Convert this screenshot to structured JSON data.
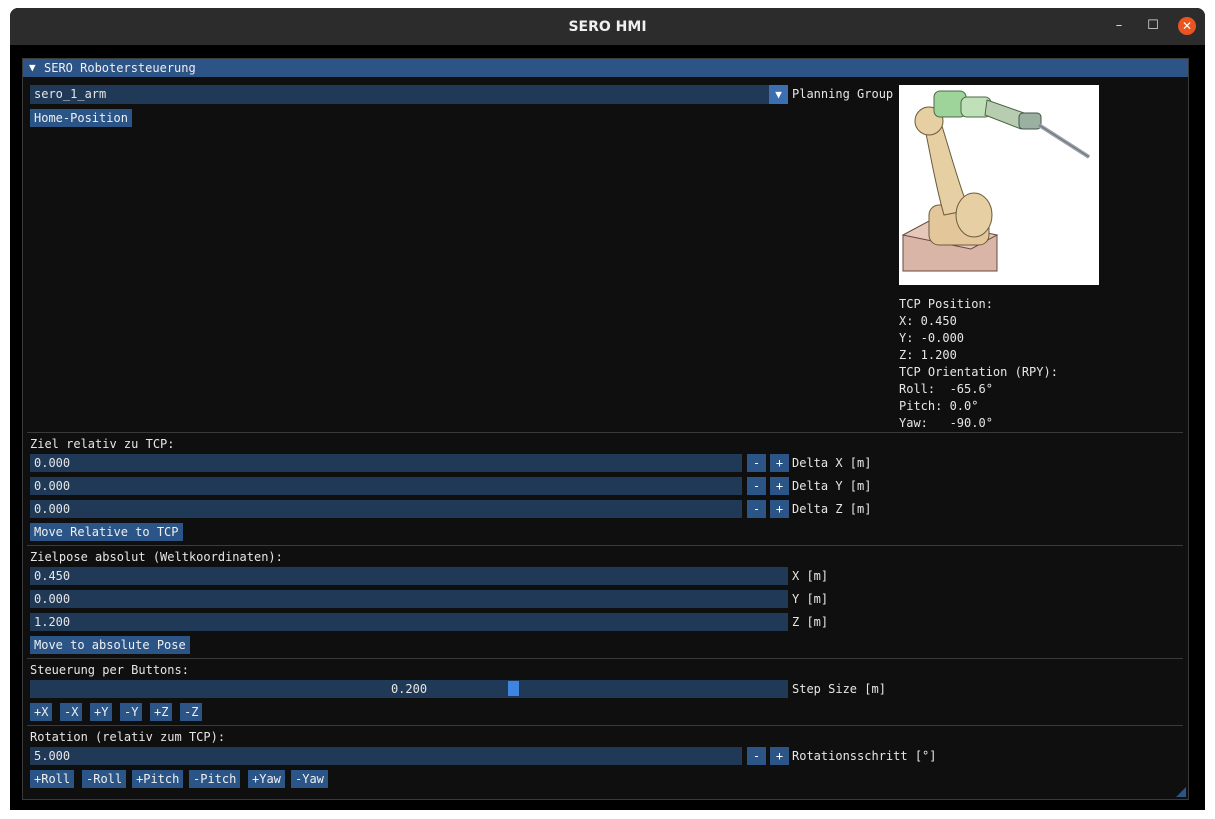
{
  "window": {
    "title": "SERO HMI",
    "min_icon": "minimize-icon",
    "max_icon": "maximize-icon",
    "close_icon": "close-icon",
    "close_color": "#e95420"
  },
  "panel": {
    "header": "SERO Robotersteuerung"
  },
  "planning": {
    "group_value": "sero_1_arm",
    "label": "Planning Group",
    "home_button": "Home-Position"
  },
  "tcp": {
    "position_title": "TCP Position:",
    "x": "X: 0.450",
    "y": "Y: -0.000",
    "z": "Z: 1.200",
    "orientation_title": "TCP Orientation (RPY):",
    "roll": "Roll:  -65.6°",
    "pitch": "Pitch: 0.0°",
    "yaw": "Yaw:   -90.0°"
  },
  "relative": {
    "title": "Ziel relativ zu TCP:",
    "dx": "0.000",
    "dx_label": "Delta X [m]",
    "dy": "0.000",
    "dy_label": "Delta Y [m]",
    "dz": "0.000",
    "dz_label": "Delta Z [m]",
    "minus": "-",
    "plus": "+",
    "move_button": "Move Relative to TCP"
  },
  "absolute": {
    "title": "Zielpose absolut (Weltkoordinaten):",
    "x": "0.450",
    "x_label": "X [m]",
    "y": "0.000",
    "y_label": "Y [m]",
    "z": "1.200",
    "z_label": "Z [m]",
    "move_button": "Move to absolute Pose"
  },
  "buttons_ctrl": {
    "title": "Steuerung per Buttons:",
    "step": "0.200",
    "step_fraction": 0.64,
    "step_label": "Step Size [m]",
    "buttons": [
      "+X",
      "-X",
      "+Y",
      "-Y",
      "+Z",
      "-Z"
    ]
  },
  "rotation": {
    "title": "Rotation (relativ zum TCP):",
    "value": "5.000",
    "label": "Rotationsschritt [°]",
    "buttons": [
      "+Roll",
      "-Roll",
      "+Pitch",
      "-Pitch",
      "+Yaw",
      "-Yaw"
    ]
  },
  "colors": {
    "accent": "#2b5487",
    "field": "#1f3957",
    "header": "#2d5486",
    "slider": "#3d85e0"
  }
}
